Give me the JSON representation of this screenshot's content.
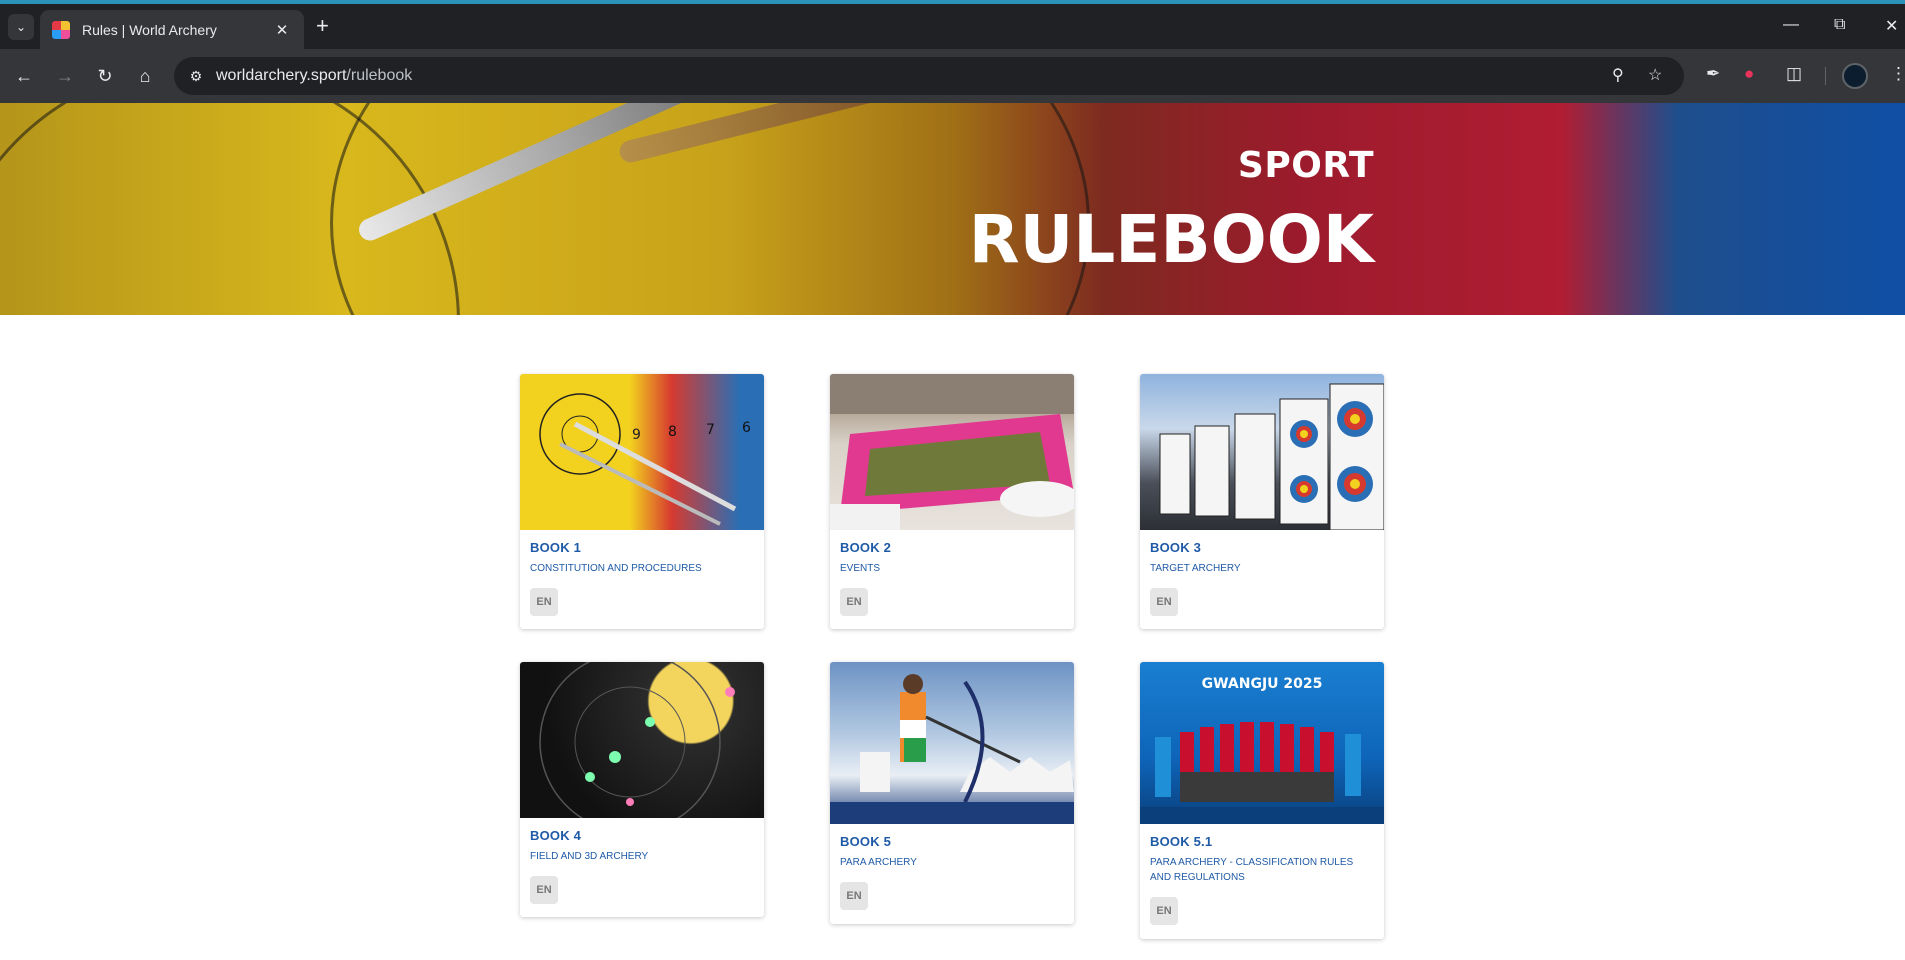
{
  "browser": {
    "tab_title": "Rules | World Archery",
    "url_host": "worldarchery.sport",
    "url_path": "/rulebook",
    "accent_color": "#2b93b8"
  },
  "hero": {
    "subtitle": "SPORT",
    "title": "RULEBOOK"
  },
  "books": [
    {
      "title": "BOOK 1",
      "description": "CONSTITUTION AND PROCEDURES",
      "lang": "EN",
      "image_marks": [
        "9",
        "8",
        "7",
        "6"
      ]
    },
    {
      "title": "BOOK 2",
      "description": "EVENTS",
      "lang": "EN"
    },
    {
      "title": "BOOK 3",
      "description": "TARGET ARCHERY",
      "lang": "EN"
    },
    {
      "title": "BOOK 4",
      "description": "FIELD AND 3D ARCHERY",
      "lang": "EN"
    },
    {
      "title": "BOOK 5",
      "description": "PARA ARCHERY",
      "lang": "EN"
    },
    {
      "title": "BOOK 5.1",
      "description": "PARA ARCHERY - CLASSIFICATION RULES AND REGULATIONS",
      "lang": "EN",
      "image_text": "GWANGJU 2025"
    }
  ],
  "colors": {
    "link_blue": "#1f5aa6",
    "lang_button_bg": "#e5e5e5"
  }
}
